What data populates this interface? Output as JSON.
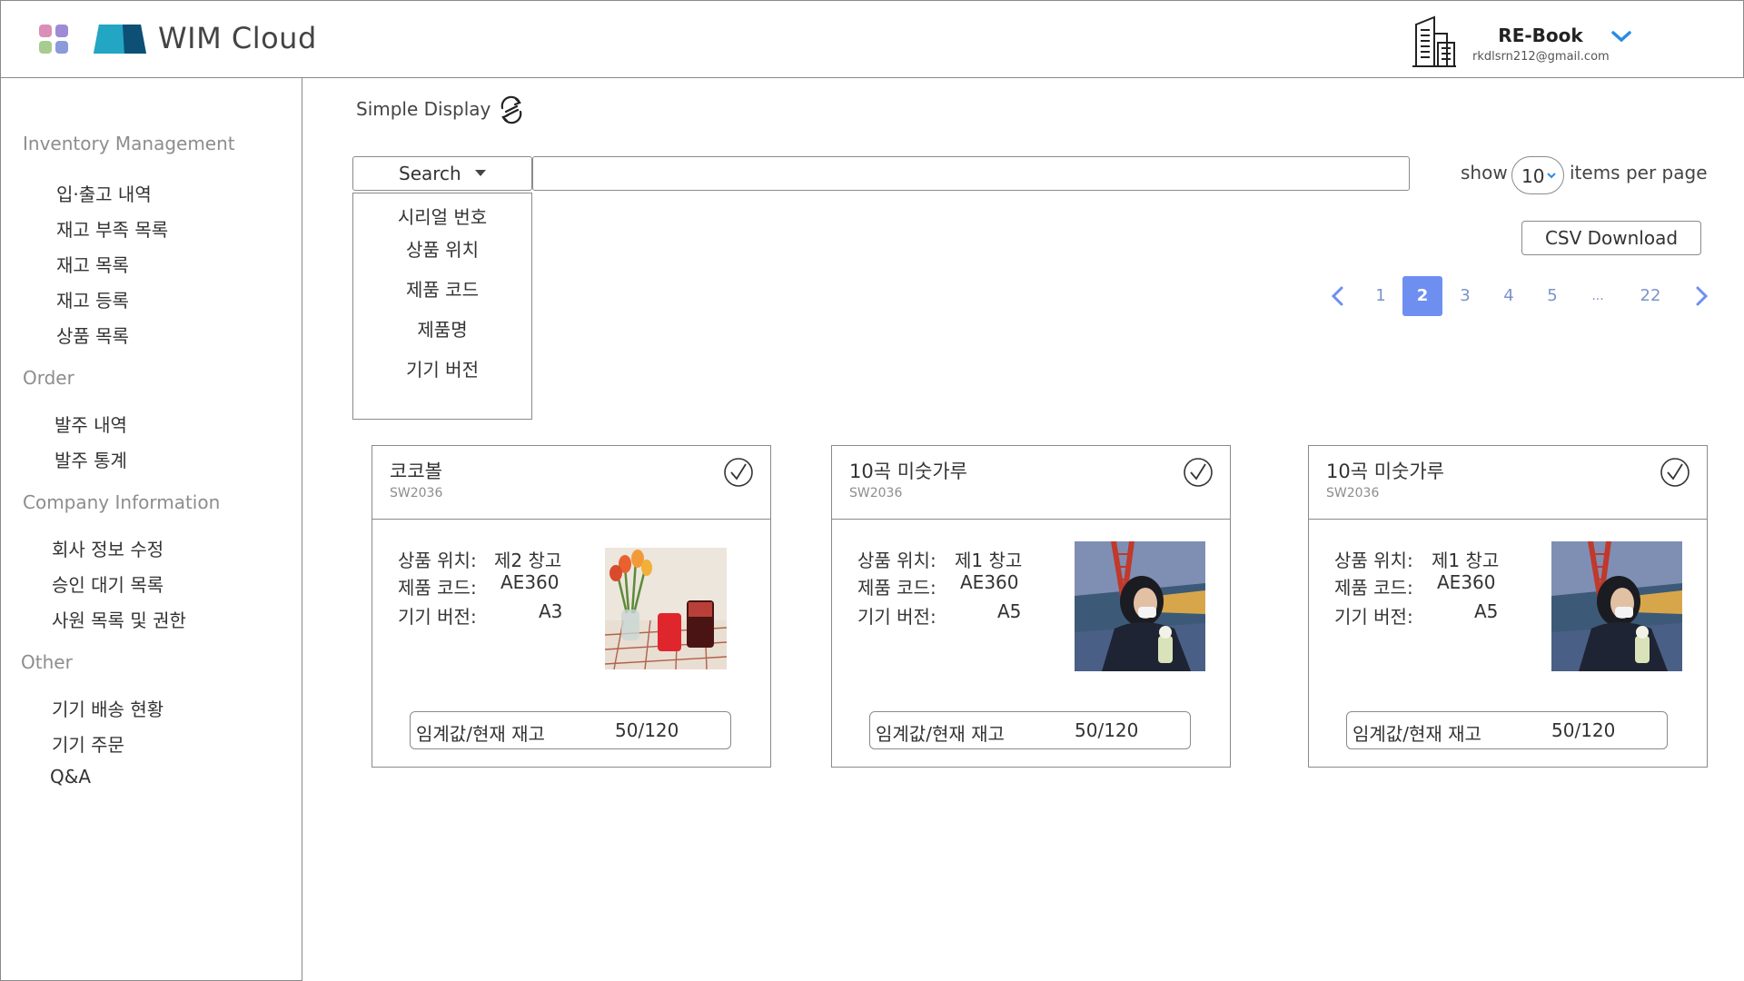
{
  "colors": {
    "accent": "#6f8ff0",
    "border": "#8a8a8a",
    "muted": "#8d8d8d",
    "logo": "#1c98b5"
  },
  "header": {
    "app_name": "WIM Cloud",
    "user": {
      "name": "RE-Book",
      "email": "rkdlsrn212@gmail.com"
    },
    "icons": [
      "apps-grid-icon",
      "cloud-logo",
      "building-icon",
      "chevron-down-icon"
    ]
  },
  "sidebar": {
    "sections": [
      {
        "title": "Inventory Management",
        "items": [
          "입·출고 내역",
          "재고 부족 목록",
          "재고 목록",
          "재고 등록",
          "상품 목록"
        ]
      },
      {
        "title": "Order",
        "items": [
          "발주 내역",
          "발주 통계"
        ]
      },
      {
        "title": "Company Information",
        "items": [
          "회사 정보 수정",
          "승인 대기 목록",
          "사원 목록 및 권한"
        ]
      },
      {
        "title": "Other",
        "items": [
          "기기 배송 현황",
          "기기 주문",
          "Q&A"
        ]
      }
    ]
  },
  "main": {
    "title": "Simple Display",
    "search": {
      "selected": "Search",
      "value": "",
      "options": [
        "시리얼 번호",
        "상품 위치",
        "제품 코드",
        "제품명",
        "기기 버전"
      ]
    },
    "show_label": "show",
    "per_page": "10",
    "items_label": "items per page",
    "csv_button": "CSV Download",
    "pagination": {
      "pages": [
        "1",
        "2",
        "3",
        "4",
        "5",
        "...",
        "22"
      ],
      "current": "2"
    },
    "cards": [
      {
        "name": "코코볼",
        "code": "SW2036",
        "location_label": "상품 위치:",
        "location": "제2 창고",
        "code_label": "제품 코드:",
        "product_code": "AE360",
        "version_label": "기기 버전:",
        "version": "A3",
        "stock_label": "임계값/현재 재고",
        "stock": "50/120",
        "image": "tulips-and-drinks-photo"
      },
      {
        "name": "10곡 미숫가루",
        "code": "SW2036",
        "location_label": "상품 위치:",
        "location": "제1 창고",
        "code_label": "제품 코드:",
        "product_code": "AE360",
        "version_label": "기기 버전:",
        "version": "A5",
        "stock_label": "임계값/현재 재고",
        "stock": "50/120",
        "image": "person-by-harbor-photo"
      },
      {
        "name": "10곡 미숫가루",
        "code": "SW2036",
        "location_label": "상품 위치:",
        "location": "제1 창고",
        "code_label": "제품 코드:",
        "product_code": "AE360",
        "version_label": "기기 버전:",
        "version": "A5",
        "stock_label": "임계값/현재 재고",
        "stock": "50/120",
        "image": "person-by-harbor-photo"
      }
    ]
  }
}
